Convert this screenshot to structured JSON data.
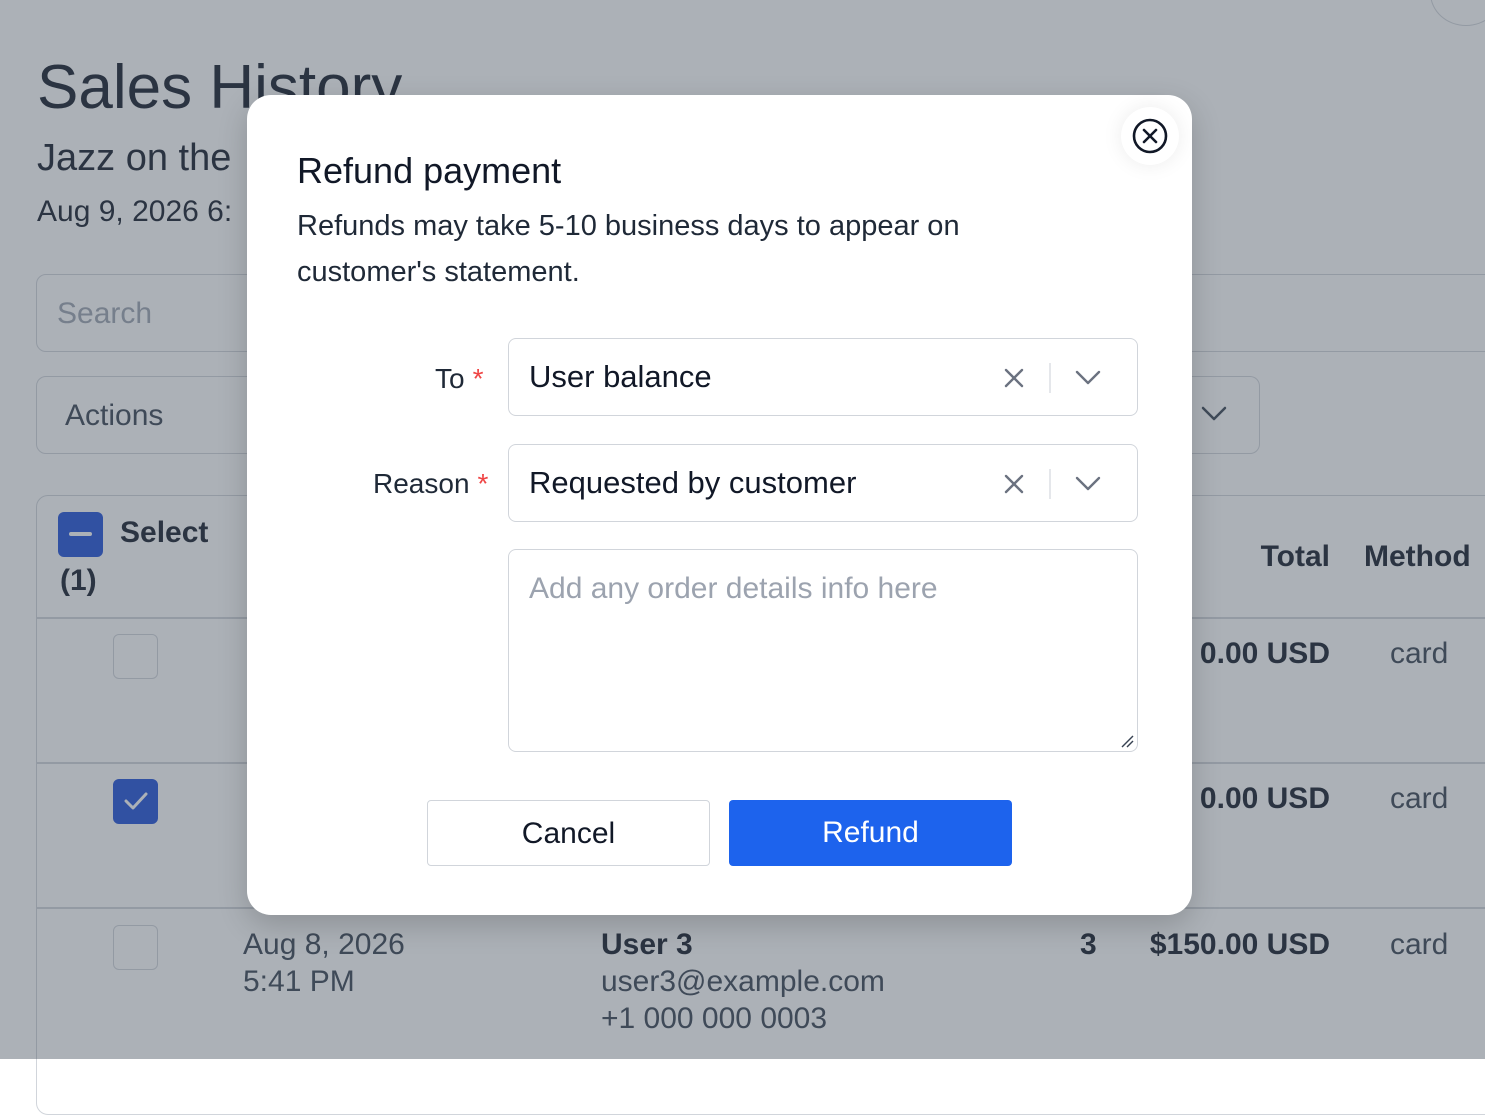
{
  "page": {
    "title": "Sales History",
    "subtitle": "Jazz on the",
    "date": "Aug 9, 2026 6:",
    "search_placeholder": "Search",
    "actions_label": "Actions"
  },
  "table": {
    "select_label": "Select",
    "select_count": "(1)",
    "headers": {
      "total": "Total",
      "method": "Method"
    },
    "rows": [
      {
        "checked": false,
        "total": "0.00 USD",
        "method": "card"
      },
      {
        "checked": true,
        "total": "0.00 USD",
        "method": "card"
      },
      {
        "checked": false,
        "date": "Aug 8, 2026",
        "time": "5:41 PM",
        "user_name": "User 3",
        "user_email": "user3@example.com",
        "user_phone": "+1 000 000 0003",
        "qty": "3",
        "total": "$150.00 USD",
        "method": "card"
      }
    ]
  },
  "modal": {
    "title": "Refund payment",
    "description": "Refunds may take 5-10 business days to appear on customer's statement.",
    "to_label": "To",
    "to_value": "User balance",
    "reason_label": "Reason",
    "reason_value": "Requested by customer",
    "required_mark": "*",
    "notes_placeholder": "Add any order details info here",
    "cancel_label": "Cancel",
    "refund_label": "Refund"
  },
  "colors": {
    "primary": "#1d63ed",
    "checkbox": "#1d4ed8",
    "required": "#ef4444",
    "overlay": "rgba(75,85,99,0.46)"
  },
  "icons": {
    "close": "close-circle-icon",
    "clear": "x-icon",
    "dropdown": "chevron-down-icon",
    "check": "check-icon",
    "resize": "resize-grip-icon"
  }
}
